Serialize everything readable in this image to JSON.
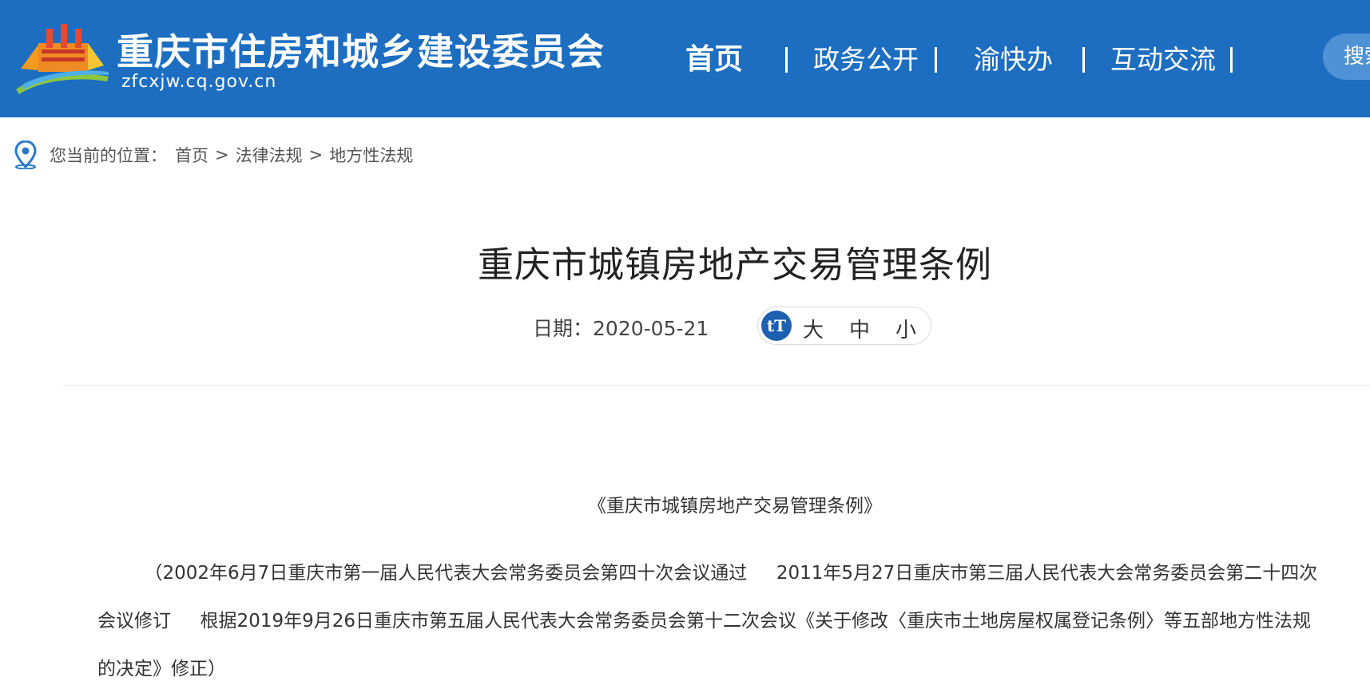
{
  "header": {
    "site_title": "重庆市住房和城乡建设委员会",
    "site_domain": "zfcxjw.cq.gov.cn",
    "nav": [
      "首页",
      "政务公开",
      "渝快办",
      "互动交流"
    ],
    "nav_separator": "|",
    "search_label": "搜索",
    "colors": {
      "header_bg": "#1d6ec1",
      "search_bg": "#4f92d6"
    }
  },
  "breadcrumb": {
    "prefix": "您当前的位置：",
    "items": [
      "首页",
      "法律法规",
      "地方性法规"
    ],
    "separator": ">"
  },
  "article": {
    "title": "重庆市城镇房地产交易管理条例",
    "date_label": "日期：",
    "date": "2020-05-21",
    "font_size_icon": "tT",
    "font_sizes": [
      "大",
      "中",
      "小"
    ],
    "doc_heading": "《重庆市城镇房地产交易管理条例》",
    "intro_lines": [
      "        （2002年6月7日重庆市第一届人民代表大会常务委员会第四十次会议通过     2011年5月27日重庆市第三届人民代表大会常务委员会第二十四次",
      "会议修订     根据2019年9月26日重庆市第五届人民代表大会常务委员会第十二次会议《关于修改〈重庆市土地房屋权属登记条例〉等五部地方性法规",
      "的决定》修正）"
    ]
  }
}
